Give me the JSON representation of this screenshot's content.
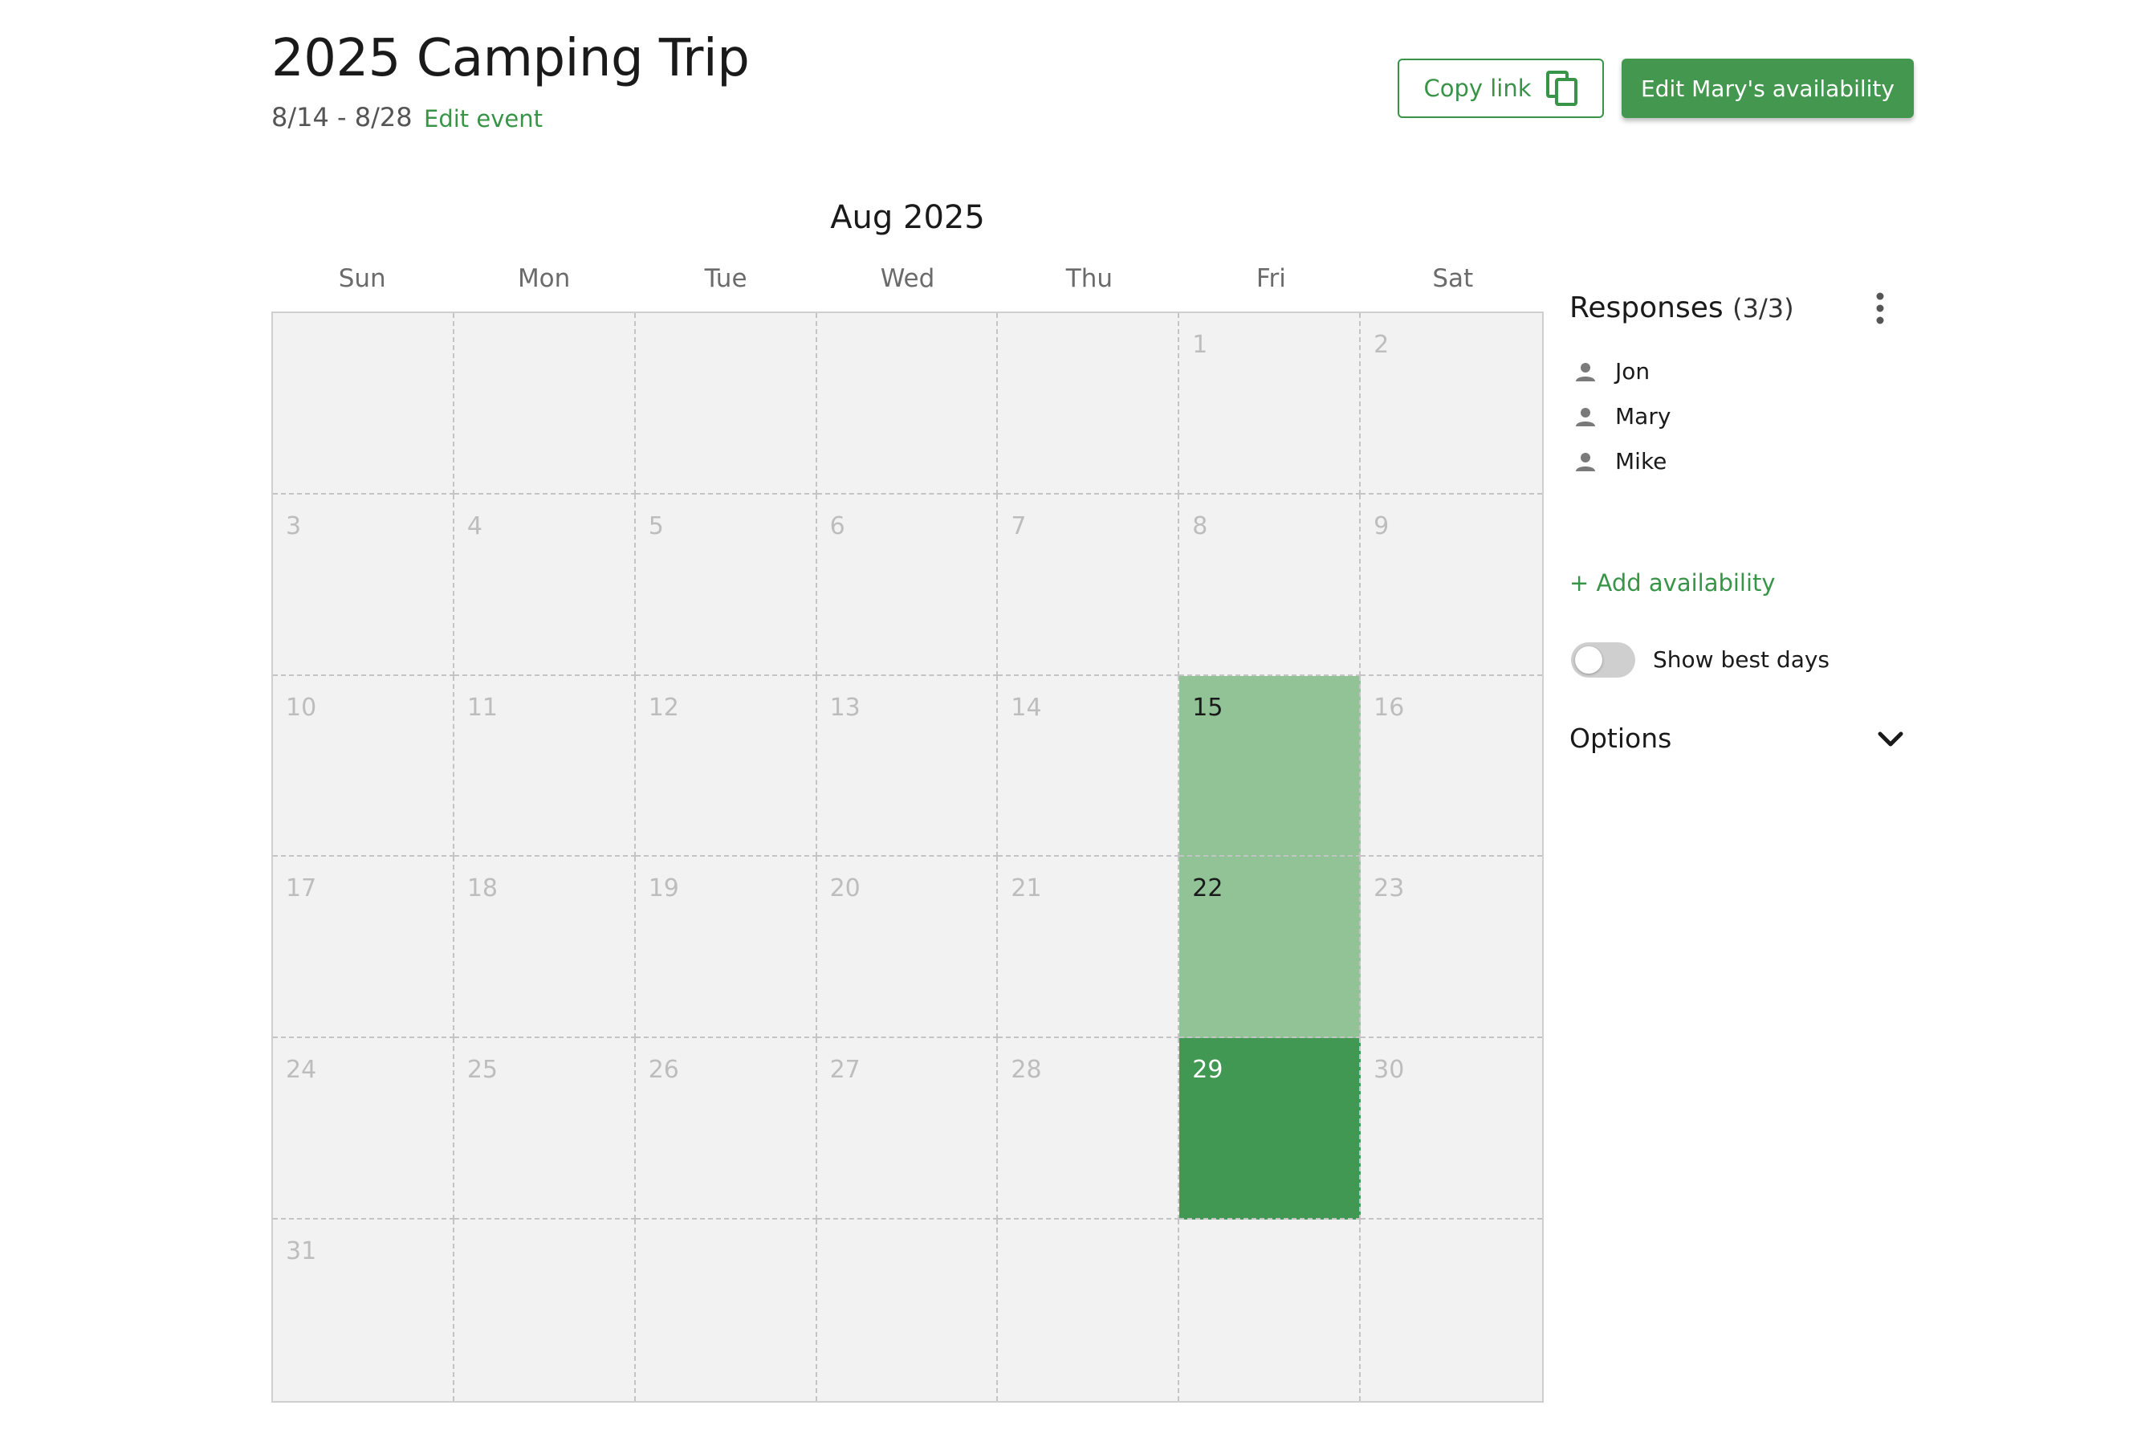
{
  "event": {
    "title": "2025 Camping Trip",
    "date_range": "8/14 - 8/28",
    "edit_label": "Edit event"
  },
  "actions": {
    "copy_link_label": "Copy link",
    "copy_icon": "copy-icon",
    "edit_availability_label": "Edit Mary's availability"
  },
  "calendar": {
    "month_label": "Aug 2025",
    "weekdays": [
      "Sun",
      "Mon",
      "Tue",
      "Wed",
      "Thu",
      "Fri",
      "Sat"
    ],
    "weeks": [
      [
        "",
        "",
        "",
        "",
        "",
        "1",
        "2"
      ],
      [
        "3",
        "4",
        "5",
        "6",
        "7",
        "8",
        "9"
      ],
      [
        "10",
        "11",
        "12",
        "13",
        "14",
        "15",
        "16"
      ],
      [
        "17",
        "18",
        "19",
        "20",
        "21",
        "22",
        "23"
      ],
      [
        "24",
        "25",
        "26",
        "27",
        "28",
        "29",
        "30"
      ],
      [
        "31",
        "",
        "",
        "",
        "",
        "",
        ""
      ]
    ],
    "highlighted_days": {
      "15": "light",
      "22": "light",
      "29": "dark"
    }
  },
  "sidebar": {
    "responses_title": "Responses",
    "responses_count": "(3/3)",
    "more_icon": "more-vertical-icon",
    "responders": [
      {
        "name": "Jon",
        "icon": "person-icon"
      },
      {
        "name": "Mary",
        "icon": "person-icon"
      },
      {
        "name": "Mike",
        "icon": "person-icon"
      }
    ],
    "add_availability_label": "+ Add availability",
    "show_best_days_label": "Show best days",
    "show_best_days_enabled": false,
    "options_label": "Options",
    "options_icon": "chevron-down-icon"
  },
  "colors": {
    "accent": "#389447",
    "button_fill": "#43974f",
    "available_light": "#92c396",
    "available_dark": "#419852",
    "cell_background": "#f2f2f2"
  }
}
